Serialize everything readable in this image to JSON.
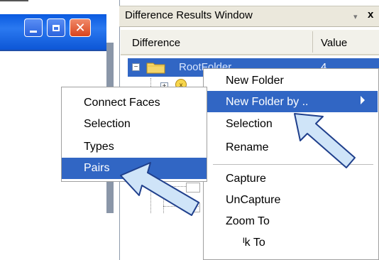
{
  "window": {
    "title": "Difference Results Window",
    "pin_glyph": "▾",
    "close_glyph": "x"
  },
  "columns": {
    "difference": "Difference",
    "value": "Value"
  },
  "tree": {
    "root_label": "RootFolder",
    "root_value": "4",
    "expander_minus": "−",
    "expander_plus": "+"
  },
  "context_menu": {
    "items": [
      {
        "label": "New Folder"
      },
      {
        "label": "New Folder by ..",
        "has_submenu": true,
        "highlighted": true
      },
      {
        "label": "Selection"
      },
      {
        "label": "Rename"
      },
      {
        "label": "Capture"
      },
      {
        "label": "UnCapture"
      },
      {
        "label": "Zoom To"
      },
      {
        "label": "ᴵk To"
      }
    ]
  },
  "submenu": {
    "items": [
      {
        "label": "Connect Faces"
      },
      {
        "label": "Selection"
      },
      {
        "label": "Types"
      },
      {
        "label": "Pairs",
        "highlighted": true
      }
    ]
  },
  "colors": {
    "highlight": "#3166c4",
    "titlebar": "#0a5ae0",
    "arrow_fill": "#cfe4f8"
  },
  "icons": {
    "minimize": "minimize-icon",
    "maximize": "maximize-icon",
    "close": "close-icon",
    "folder": "folder-icon",
    "submenu": "submenu-arrow-icon",
    "pointer": "pointer-arrow-icon"
  }
}
